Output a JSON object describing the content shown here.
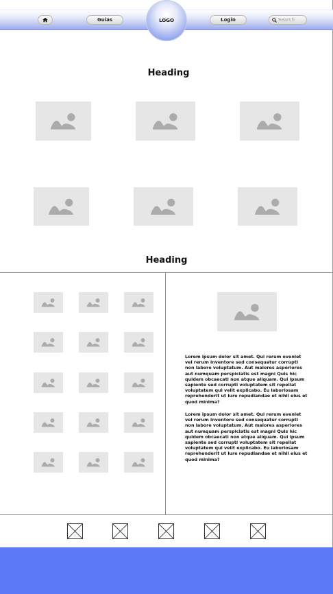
{
  "nav": {
    "home_icon": "home-icon",
    "guias_label": "Guias",
    "logo_label": "LOGO",
    "login_label": "Login",
    "search": {
      "icon": "search-icon",
      "placeholder": "Search"
    }
  },
  "headings": {
    "first": "Heading",
    "second": "Heading"
  },
  "text": {
    "paragraph_1": "Lorem ipsum dolor sit amet. Qui rerum eveniet vel rerum inventore sed consequatur corrupti non labore voluptatum. Aut maiores asperiores aut numquam perspiciatis est magni Quis hic quidem obcaecati non atque aliquam. Qui ipsum sapiente sed corrupti voluptatem sit repellat voluptatem qui velit explicabo. Eu laboriosam reprehenderit ut iure repudiandae et nihil eius et quod minima?",
    "paragraph_2": "Lorem ipsum dolor sit amet. Qui rerum eveniet vel rerum inventore sed consequatur corrupti non labore voluptatum. Aut maiores asperiores aut numquam perspiciatis est magni Quis hic quidem obcaecati non atque aliquam. Qui ipsum sapiente sed corrupti voluptatem sit repellat voluptatem qui velit explicabo. Eu laboriosam reprehenderit ut iure repudiandae et nihil eius et quod minima?"
  },
  "colors": {
    "footer": "#5b7af6",
    "placeholder_bg": "#e6e6e6",
    "placeholder_icon": "#ababab"
  }
}
